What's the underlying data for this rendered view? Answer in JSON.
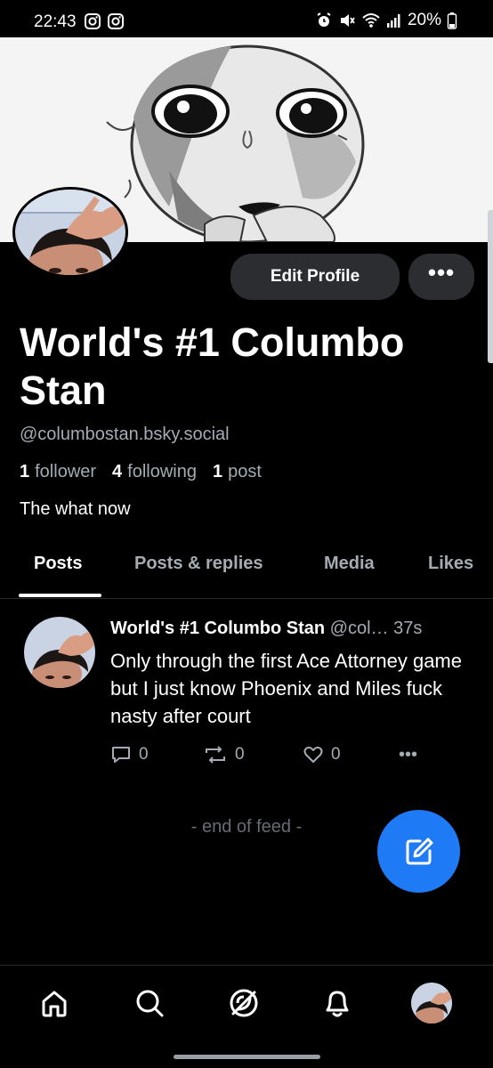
{
  "status_bar": {
    "time": "22:43",
    "battery": "20%",
    "icons": [
      "instagram-icon",
      "instagram-icon",
      "alarm-icon",
      "mute-icon",
      "wifi-icon",
      "signal-icon",
      "battery-icon"
    ]
  },
  "profile": {
    "display_name": "World's #1 Columbo Stan",
    "handle": "@columbostan.bsky.social",
    "followers_count": "1",
    "followers_label": "follower",
    "following_count": "4",
    "following_label": "following",
    "posts_count": "1",
    "posts_label": "post",
    "bio": "The what now",
    "edit_button": "Edit Profile",
    "more_button": "•••"
  },
  "tabs": [
    {
      "label": "Posts",
      "active": true
    },
    {
      "label": "Posts & replies",
      "active": false
    },
    {
      "label": "Media",
      "active": false
    },
    {
      "label": "Likes",
      "active": false
    }
  ],
  "post": {
    "author": "World's #1 Columbo Stan",
    "handle_truncated": "@col…",
    "time": "37s",
    "text": "Only through the first Ace Attorney game but I just know Phoenix and Miles fuck nasty after court",
    "reply_count": "0",
    "repost_count": "0",
    "like_count": "0",
    "more": "•••"
  },
  "feed": {
    "end_label": "- end of feed -"
  },
  "bottom_nav": [
    "home-icon",
    "search-icon",
    "feeds-icon",
    "notifications-icon",
    "profile-avatar"
  ],
  "colors": {
    "background": "#000000",
    "muted_text": "#a5abb3",
    "button_bg": "#2b2d31",
    "fab": "#1f7bf5"
  }
}
